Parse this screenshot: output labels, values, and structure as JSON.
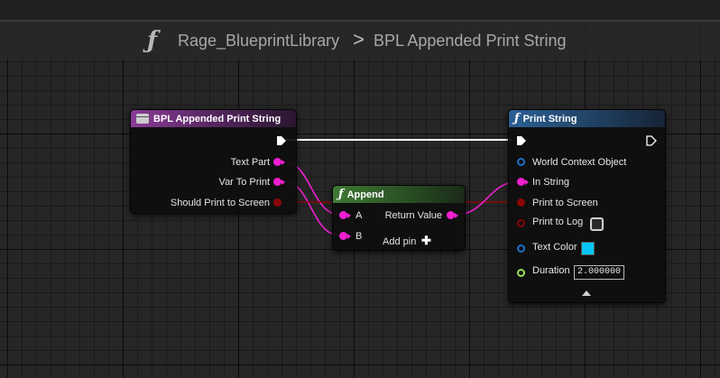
{
  "breadcrumb": {
    "function_icon": "function-icon",
    "library": "Rage_BlueprintLibrary",
    "separator": ">",
    "function": "BPL Appended Print String"
  },
  "nodes": {
    "entry": {
      "title": "BPL Appended Print String",
      "icon": "event-entry-icon",
      "pins": {
        "text_part": "Text Part",
        "var_to_print": "Var To Print",
        "should_print": "Should Print to Screen"
      }
    },
    "append": {
      "title": "Append",
      "icon": "function-icon",
      "pins": {
        "a": "A",
        "b": "B",
        "return_value": "Return Value",
        "add_pin": "Add pin",
        "add_pin_symbol": "✚"
      }
    },
    "print_string": {
      "title": "Print String",
      "icon": "function-icon",
      "pins": {
        "world_context": "World Context Object",
        "in_string": "In String",
        "print_to_screen": "Print to Screen",
        "print_to_log": "Print to Log",
        "text_color": "Text Color",
        "duration": "Duration",
        "duration_value": "2.000000"
      },
      "print_to_log_checked": false,
      "text_color": "#09c6f5"
    }
  },
  "colors": {
    "string_pin": "#f01fd2",
    "bool_pin": "#8a0707",
    "object_pin": "#1b72c4",
    "float_pin": "#9be05a",
    "exec": "#ffffff"
  }
}
